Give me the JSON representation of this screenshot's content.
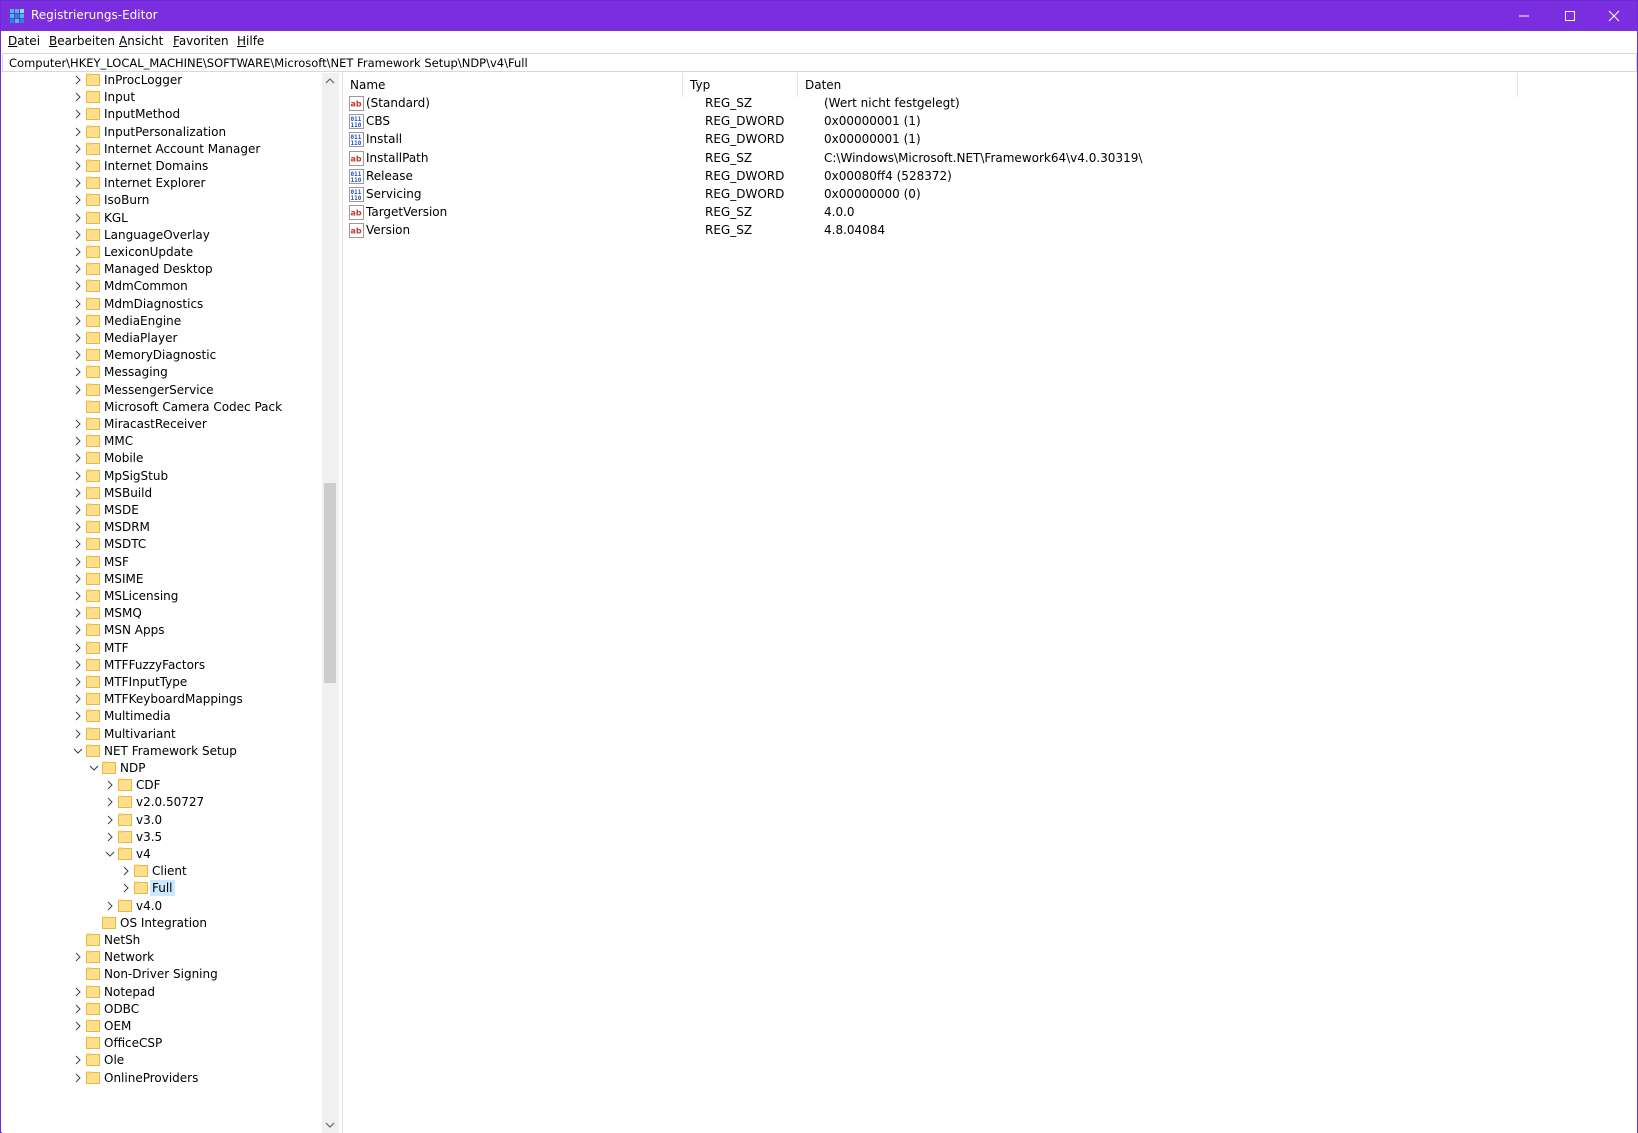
{
  "window": {
    "title": "Registrierungs-Editor",
    "accent": "#7a2ee0",
    "controls": {
      "minimize": "minimize-icon",
      "maximize": "maximize-icon",
      "close": "close-icon"
    }
  },
  "menu": {
    "items": [
      {
        "label": "Datei",
        "access": "D",
        "rest": "atei"
      },
      {
        "label": "Bearbeiten",
        "access": "B",
        "rest": "earbeiten"
      },
      {
        "label": "Ansicht",
        "access": "A",
        "rest": "nsicht"
      },
      {
        "label": "Favoriten",
        "access": "F",
        "rest": "avoriten"
      },
      {
        "label": "Hilfe",
        "access": "H",
        "rest": "ilfe"
      }
    ]
  },
  "address": {
    "path": "Computer\\HKEY_LOCAL_MACHINE\\SOFTWARE\\Microsoft\\NET Framework Setup\\NDP\\v4\\Full"
  },
  "tree": {
    "items": [
      {
        "label": "InProcLogger",
        "level": 0,
        "expander": "collapsed"
      },
      {
        "label": "Input",
        "level": 0,
        "expander": "collapsed"
      },
      {
        "label": "InputMethod",
        "level": 0,
        "expander": "collapsed"
      },
      {
        "label": "InputPersonalization",
        "level": 0,
        "expander": "collapsed"
      },
      {
        "label": "Internet Account Manager",
        "level": 0,
        "expander": "collapsed"
      },
      {
        "label": "Internet Domains",
        "level": 0,
        "expander": "collapsed"
      },
      {
        "label": "Internet Explorer",
        "level": 0,
        "expander": "collapsed"
      },
      {
        "label": "IsoBurn",
        "level": 0,
        "expander": "collapsed"
      },
      {
        "label": "KGL",
        "level": 0,
        "expander": "collapsed"
      },
      {
        "label": "LanguageOverlay",
        "level": 0,
        "expander": "collapsed"
      },
      {
        "label": "LexiconUpdate",
        "level": 0,
        "expander": "collapsed"
      },
      {
        "label": "Managed Desktop",
        "level": 0,
        "expander": "collapsed"
      },
      {
        "label": "MdmCommon",
        "level": 0,
        "expander": "collapsed"
      },
      {
        "label": "MdmDiagnostics",
        "level": 0,
        "expander": "collapsed"
      },
      {
        "label": "MediaEngine",
        "level": 0,
        "expander": "collapsed"
      },
      {
        "label": "MediaPlayer",
        "level": 0,
        "expander": "collapsed"
      },
      {
        "label": "MemoryDiagnostic",
        "level": 0,
        "expander": "collapsed"
      },
      {
        "label": "Messaging",
        "level": 0,
        "expander": "collapsed"
      },
      {
        "label": "MessengerService",
        "level": 0,
        "expander": "collapsed"
      },
      {
        "label": "Microsoft Camera Codec Pack",
        "level": 0,
        "expander": "none"
      },
      {
        "label": "MiracastReceiver",
        "level": 0,
        "expander": "collapsed"
      },
      {
        "label": "MMC",
        "level": 0,
        "expander": "collapsed"
      },
      {
        "label": "Mobile",
        "level": 0,
        "expander": "collapsed"
      },
      {
        "label": "MpSigStub",
        "level": 0,
        "expander": "collapsed"
      },
      {
        "label": "MSBuild",
        "level": 0,
        "expander": "collapsed"
      },
      {
        "label": "MSDE",
        "level": 0,
        "expander": "collapsed"
      },
      {
        "label": "MSDRM",
        "level": 0,
        "expander": "collapsed"
      },
      {
        "label": "MSDTC",
        "level": 0,
        "expander": "collapsed"
      },
      {
        "label": "MSF",
        "level": 0,
        "expander": "collapsed"
      },
      {
        "label": "MSIME",
        "level": 0,
        "expander": "collapsed"
      },
      {
        "label": "MSLicensing",
        "level": 0,
        "expander": "collapsed"
      },
      {
        "label": "MSMQ",
        "level": 0,
        "expander": "collapsed"
      },
      {
        "label": "MSN Apps",
        "level": 0,
        "expander": "collapsed"
      },
      {
        "label": "MTF",
        "level": 0,
        "expander": "collapsed"
      },
      {
        "label": "MTFFuzzyFactors",
        "level": 0,
        "expander": "collapsed"
      },
      {
        "label": "MTFInputType",
        "level": 0,
        "expander": "collapsed"
      },
      {
        "label": "MTFKeyboardMappings",
        "level": 0,
        "expander": "collapsed"
      },
      {
        "label": "Multimedia",
        "level": 0,
        "expander": "collapsed"
      },
      {
        "label": "Multivariant",
        "level": 0,
        "expander": "collapsed"
      },
      {
        "label": "NET Framework Setup",
        "level": 0,
        "expander": "expanded"
      },
      {
        "label": "NDP",
        "level": 1,
        "expander": "expanded"
      },
      {
        "label": "CDF",
        "level": 2,
        "expander": "collapsed"
      },
      {
        "label": "v2.0.50727",
        "level": 2,
        "expander": "collapsed"
      },
      {
        "label": "v3.0",
        "level": 2,
        "expander": "collapsed"
      },
      {
        "label": "v3.5",
        "level": 2,
        "expander": "collapsed"
      },
      {
        "label": "v4",
        "level": 2,
        "expander": "expanded"
      },
      {
        "label": "Client",
        "level": 3,
        "expander": "collapsed"
      },
      {
        "label": "Full",
        "level": 3,
        "expander": "collapsed",
        "selected": true
      },
      {
        "label": "v4.0",
        "level": 2,
        "expander": "collapsed"
      },
      {
        "label": "OS Integration",
        "level": 1,
        "expander": "none"
      },
      {
        "label": "NetSh",
        "level": 0,
        "expander": "none"
      },
      {
        "label": "Network",
        "level": 0,
        "expander": "collapsed"
      },
      {
        "label": "Non-Driver Signing",
        "level": 0,
        "expander": "none"
      },
      {
        "label": "Notepad",
        "level": 0,
        "expander": "collapsed"
      },
      {
        "label": "ODBC",
        "level": 0,
        "expander": "collapsed"
      },
      {
        "label": "OEM",
        "level": 0,
        "expander": "collapsed"
      },
      {
        "label": "OfficeCSP",
        "level": 0,
        "expander": "none"
      },
      {
        "label": "Ole",
        "level": 0,
        "expander": "collapsed"
      },
      {
        "label": "OnlineProviders",
        "level": 0,
        "expander": "collapsed"
      }
    ]
  },
  "values": {
    "columns": [
      "Name",
      "Typ",
      "Daten"
    ],
    "rows": [
      {
        "icon": "string-value-icon",
        "name": "(Standard)",
        "type": "REG_SZ",
        "data": "(Wert nicht festgelegt)"
      },
      {
        "icon": "binary-value-icon",
        "name": "CBS",
        "type": "REG_DWORD",
        "data": "0x00000001 (1)"
      },
      {
        "icon": "binary-value-icon",
        "name": "Install",
        "type": "REG_DWORD",
        "data": "0x00000001 (1)"
      },
      {
        "icon": "string-value-icon",
        "name": "InstallPath",
        "type": "REG_SZ",
        "data": "C:\\Windows\\Microsoft.NET\\Framework64\\v4.0.30319\\"
      },
      {
        "icon": "binary-value-icon",
        "name": "Release",
        "type": "REG_DWORD",
        "data": "0x00080ff4 (528372)"
      },
      {
        "icon": "binary-value-icon",
        "name": "Servicing",
        "type": "REG_DWORD",
        "data": "0x00000000 (0)"
      },
      {
        "icon": "string-value-icon",
        "name": "TargetVersion",
        "type": "REG_SZ",
        "data": "4.0.0"
      },
      {
        "icon": "string-value-icon",
        "name": "Version",
        "type": "REG_SZ",
        "data": "4.8.04084"
      }
    ]
  }
}
